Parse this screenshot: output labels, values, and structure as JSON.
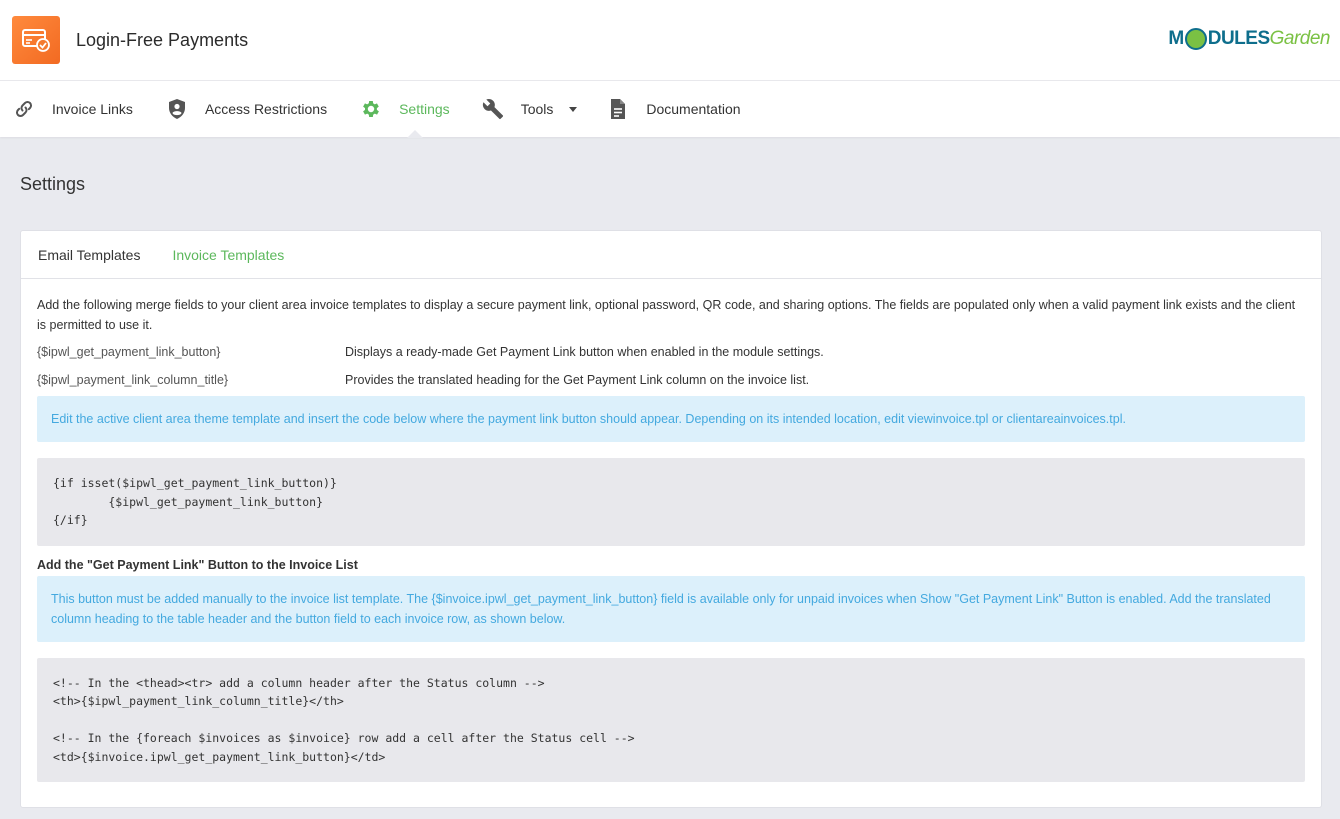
{
  "app": {
    "title": "Login-Free Payments",
    "icon": "credit-card-check-icon",
    "accent": "#f47b2f"
  },
  "brand": {
    "part1": "M",
    "part2": "DULES",
    "part3": "Garden"
  },
  "nav": {
    "items": [
      {
        "label": "Invoice Links",
        "icon": "link-icon",
        "active": false
      },
      {
        "label": "Access Restrictions",
        "icon": "shield-icon",
        "active": false
      },
      {
        "label": "Settings",
        "icon": "gear-icon",
        "active": true
      },
      {
        "label": "Tools",
        "icon": "wrench-icon",
        "active": false
      },
      {
        "label": "Documentation",
        "icon": "document-icon",
        "active": false
      }
    ],
    "active_color": "#5cb85c"
  },
  "page": {
    "title": "Settings"
  },
  "tabs": [
    {
      "label": "Email Templates",
      "active": false
    },
    {
      "label": "Invoice Templates",
      "active": true
    }
  ],
  "content": {
    "intro": "Add the following merge fields to your client area invoice templates to display a secure payment link, optional password, QR code, and sharing options. The fields are populated only when a valid payment link exists and the client is permitted to use it.",
    "fields": [
      {
        "code": "{$ipwl_get_payment_link_button}",
        "desc": "Displays a ready-made Get Payment Link button when enabled in the module settings."
      },
      {
        "code": "{$ipwl_payment_link_column_title}",
        "desc": "Provides the translated heading for the Get Payment Link column on the invoice list."
      }
    ],
    "info1": "Edit the active client area theme template and insert the code below where the payment link button should appear. Depending on its intended location, edit viewinvoice.tpl or clientareainvoices.tpl.",
    "code1": "{if isset($ipwl_get_payment_link_button)}\n        {$ipwl_get_payment_link_button}\n{/if}",
    "subhead": "Add the \"Get Payment Link\" Button to the Invoice List",
    "info2": "This button must be added manually to the invoice list template. The {$invoice.ipwl_get_payment_link_button} field is available only for unpaid invoices when Show \"Get Payment Link\" Button is enabled. Add the translated column heading to the table header and the button field to each invoice row, as shown below.",
    "code2": "<!-- In the <thead><tr> add a column header after the Status column -->\n<th>{$ipwl_payment_link_column_title}</th>\n\n<!-- In the {foreach $invoices as $invoice} row add a cell after the Status cell -->\n<td>{$invoice.ipwl_get_payment_link_button}</td>"
  }
}
